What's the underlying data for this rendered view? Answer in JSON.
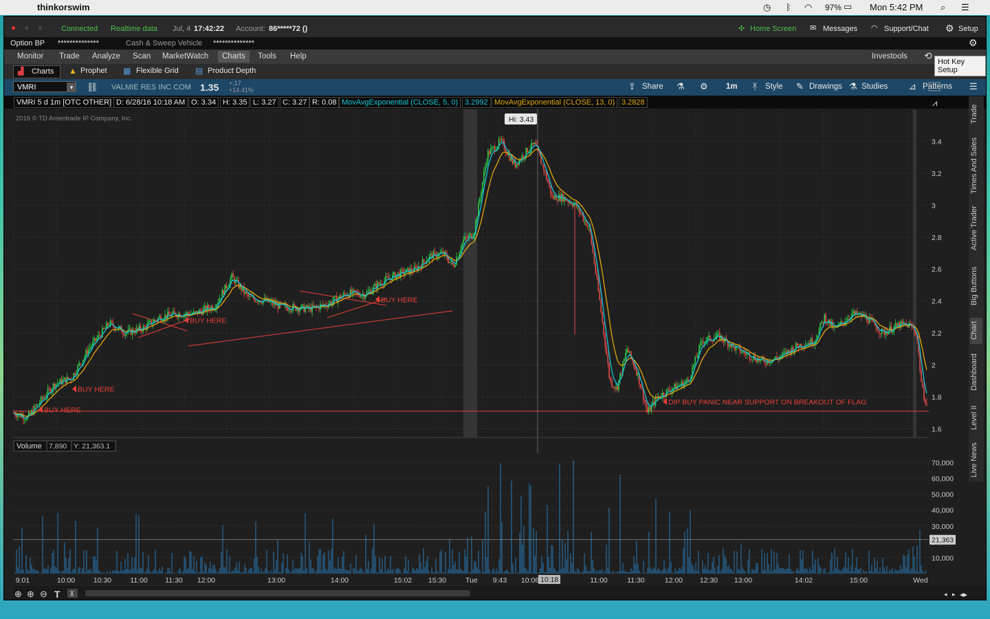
{
  "menubar": {
    "app_name": "thinkorswim",
    "battery": "97%",
    "clock": "Mon 5:42 PM"
  },
  "status": {
    "connected": "Connected",
    "realtime": "Realtime data",
    "date": "Jul, 4",
    "time": "17:42:22",
    "account_label": "Account:",
    "account_value": "86*****72 ()",
    "home_screen": "Home Screen",
    "messages": "Messages",
    "support": "Support/Chat",
    "setup": "Setup"
  },
  "option_row": {
    "option_bp": "Option BP",
    "option_bp_value": "**************",
    "cash_sweep": "Cash & Sweep Vehicle",
    "cash_sweep_value": "**************"
  },
  "nav": {
    "items": [
      "Monitor",
      "Trade",
      "Analyze",
      "Scan",
      "MarketWatch",
      "Charts",
      "Tools",
      "Help"
    ],
    "investools": "Investools",
    "hotkey": "Hot Key Setup"
  },
  "subnav": {
    "items": [
      "Charts",
      "Prophet",
      "Flexible Grid",
      "Product Depth"
    ]
  },
  "toolbar": {
    "symbol": "VMRI",
    "company": "VALMIE RES INC COM",
    "price": "1.35",
    "change": "+.17",
    "change_pct": "+14.41%",
    "share": "Share",
    "timeframe": "1m",
    "style": "Style",
    "drawings": "Drawings",
    "studies": "Studies",
    "patterns": "Patterns"
  },
  "study_row": {
    "desc": "VMRI 5 d 1m [OTC OTHER]",
    "date": "D: 6/28/16 10:18 AM",
    "open": "O: 3.34",
    "high": "H: 3.35",
    "low": "L: 3.27",
    "close": "C: 3.27",
    "range": "R: 0.08",
    "ema5_label": "MovAvgExponential (CLOSE, 5, 0)",
    "ema5_value": "3.2992",
    "ema13_label": "MovAvgExponential (CLOSE, 13, 0)",
    "ema13_value": "3.2828"
  },
  "colors": {
    "candle_up": "#2fd24a",
    "candle_down": "#e84a4a",
    "ema_fast": "#14c6d8",
    "ema_slow": "#e0a810",
    "annotation": "#e8403a",
    "volume": "#2a78b4",
    "tab_bg": "#1d4766"
  },
  "chart_data": [
    {
      "type": "candlestick",
      "title": "VMRI 5 d 1m [OTC OTHER]",
      "copyright": "2016 © TD Ameritrade IP Company, Inc.",
      "y_ticks": [
        "3.4",
        "3.2",
        "3",
        "2.8",
        "2.6",
        "2.4",
        "2.2",
        "2",
        "1.8",
        "1.6"
      ],
      "ylim": [
        1.55,
        3.6
      ],
      "x_ticks": [
        "9:01",
        "10:00",
        "10:30",
        "11:00",
        "11:30",
        "12:00",
        "13:00",
        "14:00",
        "15:02",
        "15:30",
        "Tue",
        "9:43",
        "10:06",
        "11:00",
        "11:30",
        "12:00",
        "12:30",
        "13:00",
        "14:02",
        "15:00",
        "Wed"
      ],
      "cursor_time": "10:18",
      "high_marker": "Hi: 3.43",
      "series": [
        {
          "name": "MovAvgExponential (CLOSE, 5, 0)"
        },
        {
          "name": "MovAvgExponential (CLOSE, 13, 0)"
        }
      ],
      "path": [
        [
          0,
          1.7
        ],
        [
          20,
          1.67
        ],
        [
          35,
          1.75
        ],
        [
          60,
          1.88
        ],
        [
          85,
          1.92
        ],
        [
          110,
          2.1
        ],
        [
          140,
          2.26
        ],
        [
          165,
          2.2
        ],
        [
          190,
          2.23
        ],
        [
          215,
          2.3
        ],
        [
          240,
          2.32
        ],
        [
          265,
          2.32
        ],
        [
          295,
          2.37
        ],
        [
          320,
          2.55
        ],
        [
          345,
          2.42
        ],
        [
          370,
          2.4
        ],
        [
          395,
          2.36
        ],
        [
          410,
          2.36
        ],
        [
          435,
          2.35
        ],
        [
          460,
          2.38
        ],
        [
          490,
          2.45
        ],
        [
          515,
          2.44
        ],
        [
          540,
          2.52
        ],
        [
          565,
          2.57
        ],
        [
          590,
          2.6
        ],
        [
          610,
          2.68
        ],
        [
          630,
          2.7
        ],
        [
          645,
          2.62
        ],
        [
          660,
          2.78
        ],
        [
          675,
          2.82
        ],
        [
          695,
          3.32
        ],
        [
          715,
          3.4
        ],
        [
          735,
          3.25
        ],
        [
          755,
          3.35
        ],
        [
          765,
          3.38
        ],
        [
          780,
          3.2
        ],
        [
          790,
          3.05
        ],
        [
          805,
          3.05
        ],
        [
          825,
          3.0
        ],
        [
          845,
          2.85
        ],
        [
          860,
          2.4
        ],
        [
          875,
          1.9
        ],
        [
          885,
          1.85
        ],
        [
          900,
          2.1
        ],
        [
          915,
          1.95
        ],
        [
          930,
          1.7
        ],
        [
          945,
          1.8
        ],
        [
          965,
          1.85
        ],
        [
          990,
          1.9
        ],
        [
          1010,
          2.15
        ],
        [
          1035,
          2.18
        ],
        [
          1060,
          2.1
        ],
        [
          1085,
          2.05
        ],
        [
          1100,
          2.02
        ],
        [
          1125,
          2.05
        ],
        [
          1150,
          2.12
        ],
        [
          1175,
          2.15
        ],
        [
          1190,
          2.3
        ],
        [
          1205,
          2.22
        ],
        [
          1230,
          2.32
        ],
        [
          1250,
          2.3
        ],
        [
          1275,
          2.2
        ],
        [
          1300,
          2.25
        ],
        [
          1315,
          2.25
        ],
        [
          1325,
          2.2
        ],
        [
          1333,
          1.85
        ],
        [
          1340,
          1.75
        ]
      ],
      "annotations": [
        {
          "text": "BUY HERE",
          "time": "9:08",
          "price": 1.72
        },
        {
          "text": "BUY HERE",
          "time": "9:40",
          "price": 1.85
        },
        {
          "text": "BUY HERE",
          "time": "11:20",
          "price": 2.28
        },
        {
          "text": "BUY HERE",
          "time": "14:40",
          "price": 2.41
        },
        {
          "text": "DIP BUY PANIC NEAR SUPPORT ON BREAKOUT OF FLAG",
          "time": "11:57",
          "price": 1.77
        }
      ],
      "support_line": 1.71
    },
    {
      "type": "bar",
      "title": "Volume",
      "current": "7,890",
      "cursor_y": "Y: 21,363.1",
      "y_ticks": [
        "70,000",
        "60,000",
        "50,000",
        "40,000",
        "30,000",
        "20,000",
        "10,000"
      ],
      "ylim": [
        0,
        75000
      ],
      "cursor_value_label": "21,363"
    }
  ]
}
